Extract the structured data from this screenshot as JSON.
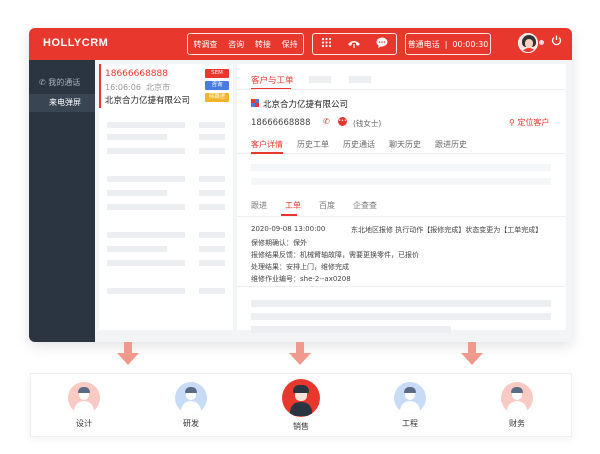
{
  "brand": "HOLLYCRM",
  "toolbar": {
    "group1": [
      "转调查",
      "咨询",
      "转接",
      "保持"
    ],
    "call_mode": "普通电话",
    "call_timer": "00:00:30"
  },
  "sidebar": {
    "items": [
      {
        "label": "我的通话",
        "icon": "phone-icon"
      },
      {
        "label": "来电弹屏"
      }
    ]
  },
  "call_card": {
    "phone": "18666668888",
    "time": "16:06:06",
    "city": "北京市",
    "company": "北京合力亿捷有限公司",
    "tags": [
      "SEM",
      "咨询",
      "待跟进"
    ]
  },
  "main": {
    "title": "客户与工单",
    "company": "北京合力亿捷有限公司",
    "phone": "18666668888",
    "person": "(钱女士)",
    "locate": "定位客户",
    "tabs": [
      "客户详情",
      "历史工单",
      "历史通话",
      "聊天历史",
      "跟进历史"
    ],
    "subtabs": [
      "跟进",
      "工单",
      "百度",
      "企查查"
    ],
    "record": {
      "datetime": "2020-09-08 13:00:00",
      "action": "东北地区报修 执行动作【报修完成】状态变更为【工单完成】",
      "lines": [
        "保修期确认：保外",
        "报修结果反馈：机械臂轴故障，需要更换零件，已报价",
        "处理结果：安排上门，维修完成",
        "维修作业编号：she-2--ax0208"
      ]
    }
  },
  "teams": [
    {
      "label": "设计",
      "color": "#f9c9c4"
    },
    {
      "label": "研发",
      "color": "#c7dbf6"
    },
    {
      "label": "销售",
      "color": "#e8382e"
    },
    {
      "label": "工程",
      "color": "#c7dbf6"
    },
    {
      "label": "财务",
      "color": "#f9c9c4"
    }
  ],
  "colors": {
    "accent": "#e8382e",
    "sidebar": "#2b3542"
  }
}
